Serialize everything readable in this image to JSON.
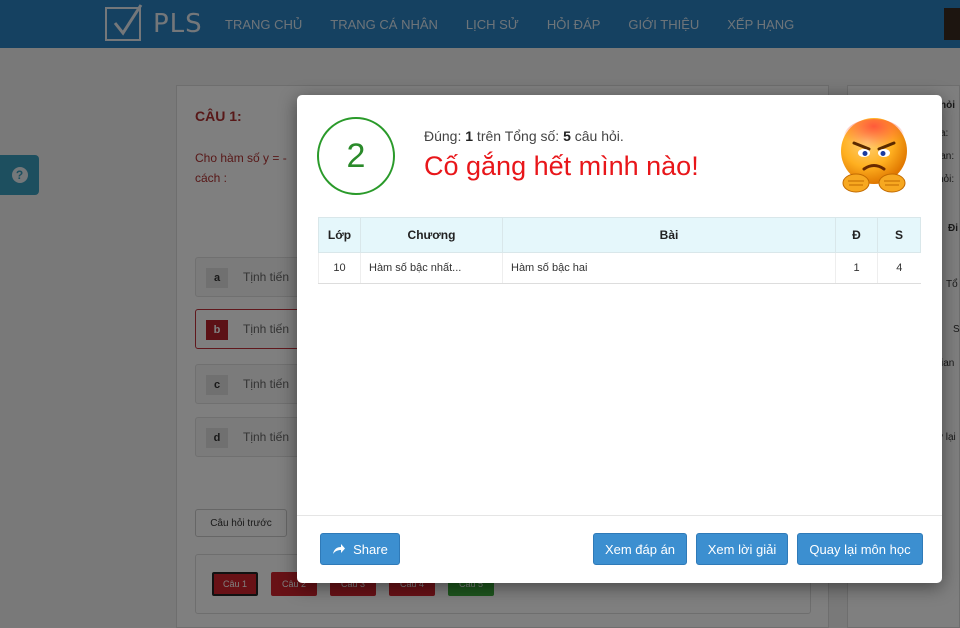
{
  "navbar": {
    "logo_text": "PLS",
    "items": [
      {
        "label": "TRANG CHỦ"
      },
      {
        "label": "TRANG CÁ NHÂN"
      },
      {
        "label": "LỊCH SỬ"
      },
      {
        "label": "HỎI ĐÁP"
      },
      {
        "label": "GIỚI THIỆU"
      },
      {
        "label": "XẾP HẠNG"
      }
    ],
    "help_icon": "?"
  },
  "background": {
    "question_title": "CÂU 1:",
    "question_text": "Cho hàm số y = -",
    "question_text_2": "cách :",
    "answers": [
      {
        "letter": "a",
        "text": "Tịnh tiến"
      },
      {
        "letter": "b",
        "text": "Tịnh tiến"
      },
      {
        "letter": "c",
        "text": "Tịnh tiến"
      },
      {
        "letter": "d",
        "text": "Tịnh tiến"
      }
    ],
    "prev_button": "Câu hỏi trước",
    "question_buttons": [
      {
        "label": "Câu 1"
      },
      {
        "label": "Câu 2"
      },
      {
        "label": "Câu 3"
      },
      {
        "label": "Câu 4"
      },
      {
        "label": "Câu 5"
      }
    ],
    "side_fragments": [
      "hỏi",
      "a:",
      "ian:",
      "hỏi:",
      "Đi",
      "Tổ",
      "S",
      "ian",
      "y lại"
    ]
  },
  "modal": {
    "score": "2",
    "summary_prefix": "Đúng: ",
    "correct": "1",
    "summary_middle": " trên Tổng số: ",
    "total": "5",
    "summary_suffix": " câu hỏi.",
    "headline": "Cố gắng hết mình nào!",
    "emoji_icon": "angry-face",
    "table": {
      "headers": [
        "Lớp",
        "Chương",
        "Bài",
        "Đ",
        "S"
      ],
      "rows": [
        {
          "lop": "10",
          "chuong": "Hàm số bậc nhất...",
          "bai": "Hàm số bậc hai",
          "dung": "1",
          "sai": "4"
        }
      ]
    },
    "buttons": {
      "share": "Share",
      "answers": "Xem đáp án",
      "solutions": "Xem lời giải",
      "back": "Quay lại môn học"
    }
  },
  "colors": {
    "navbar": "#2a82c2",
    "score_ring": "#2a9a2a",
    "headline": "#e8161a",
    "primary_button": "#3c8fd0",
    "wrong": "#d0232c",
    "right": "#3aab3a"
  }
}
